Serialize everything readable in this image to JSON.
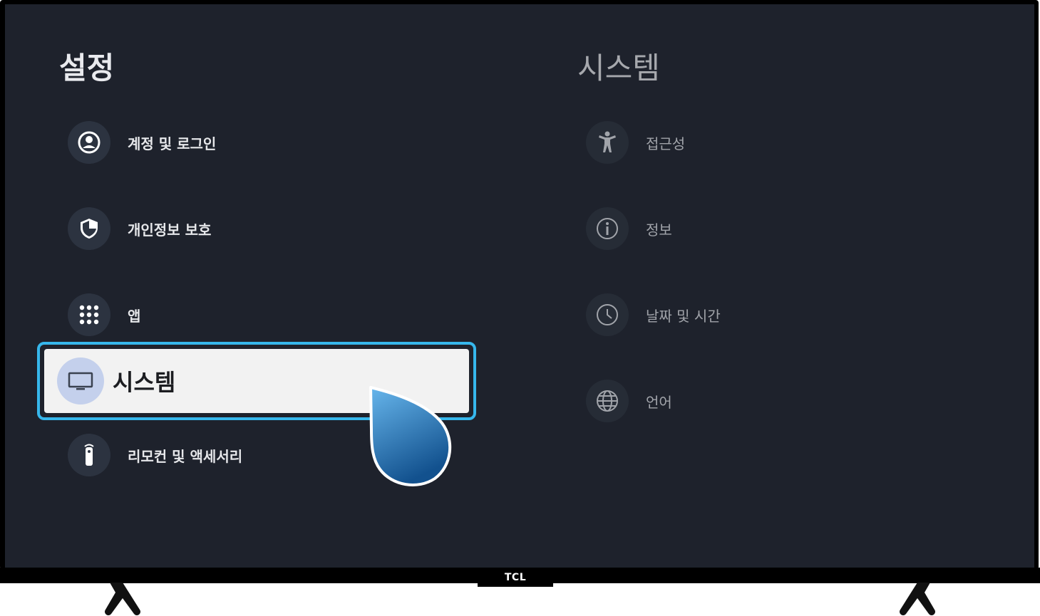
{
  "brand": "TCL",
  "left_panel": {
    "title": "설정",
    "items": [
      {
        "label": "계정 및 로그인",
        "icon": "account-circle-icon"
      },
      {
        "label": "개인정보 보호",
        "icon": "shield-icon"
      },
      {
        "label": "앱",
        "icon": "apps-grid-icon"
      },
      {
        "label": "시스템",
        "icon": "tv-icon",
        "selected": true
      },
      {
        "label": "리모컨 및 액세서리",
        "icon": "remote-icon"
      }
    ]
  },
  "right_panel": {
    "title": "시스템",
    "items": [
      {
        "label": "접근성",
        "icon": "accessibility-icon"
      },
      {
        "label": "정보",
        "icon": "info-icon"
      },
      {
        "label": "날짜 및 시간",
        "icon": "clock-icon"
      },
      {
        "label": "언어",
        "icon": "globe-icon"
      }
    ]
  },
  "colors": {
    "background": "#1e222c",
    "focus_border": "#36b7ec",
    "focus_fill": "#f2f2f2",
    "pointer": "#1f6fb3"
  }
}
